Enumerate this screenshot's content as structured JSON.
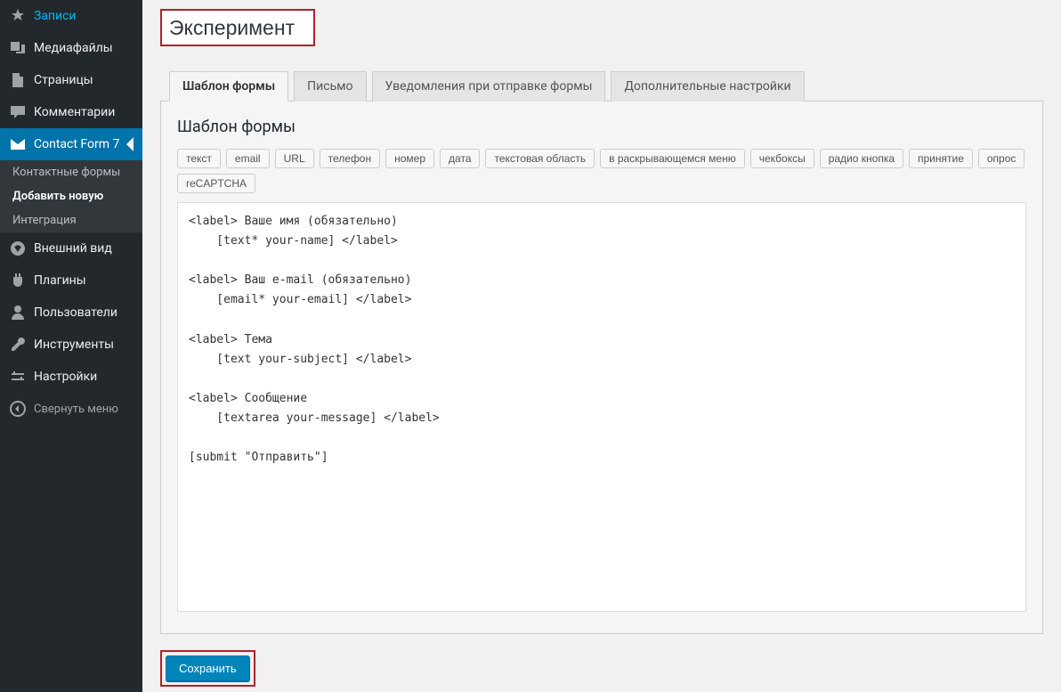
{
  "title_input": "Эксперимент",
  "sidebar": {
    "items": [
      {
        "label": "Записи",
        "icon": "pin-icon"
      },
      {
        "label": "Медиафайлы",
        "icon": "media-icon"
      },
      {
        "label": "Страницы",
        "icon": "pages-icon"
      },
      {
        "label": "Комментарии",
        "icon": "comment-icon"
      },
      {
        "label": "Contact Form 7",
        "icon": "mail-icon",
        "active": true
      },
      {
        "label": "Внешний вид",
        "icon": "appearance-icon"
      },
      {
        "label": "Плагины",
        "icon": "plugins-icon"
      },
      {
        "label": "Пользователи",
        "icon": "users-icon"
      },
      {
        "label": "Инструменты",
        "icon": "tools-icon"
      },
      {
        "label": "Настройки",
        "icon": "settings-icon"
      }
    ],
    "sub_items": [
      {
        "label": "Контактные формы"
      },
      {
        "label": "Добавить новую",
        "current": true
      },
      {
        "label": "Интеграция"
      }
    ],
    "collapse": "Свернуть меню"
  },
  "tabs": [
    {
      "label": "Шаблон формы",
      "active": true
    },
    {
      "label": "Письмо"
    },
    {
      "label": "Уведомления при отправке формы"
    },
    {
      "label": "Дополнительные настройки"
    }
  ],
  "panel_heading": "Шаблон формы",
  "tag_buttons": [
    "текст",
    "email",
    "URL",
    "телефон",
    "номер",
    "дата",
    "текстовая область",
    "в раскрывающемся меню",
    "чекбоксы",
    "радио кнопка",
    "принятие",
    "опрос",
    "reCAPTCHA"
  ],
  "form_code": "<label> Ваше имя (обязательно)\n    [text* your-name] </label>\n\n<label> Ваш e-mail (обязательно)\n    [email* your-email] </label>\n\n<label> Тема\n    [text your-subject] </label>\n\n<label> Сообщение\n    [textarea your-message] </label>\n\n[submit \"Отправить\"]",
  "save_label": "Сохранить"
}
